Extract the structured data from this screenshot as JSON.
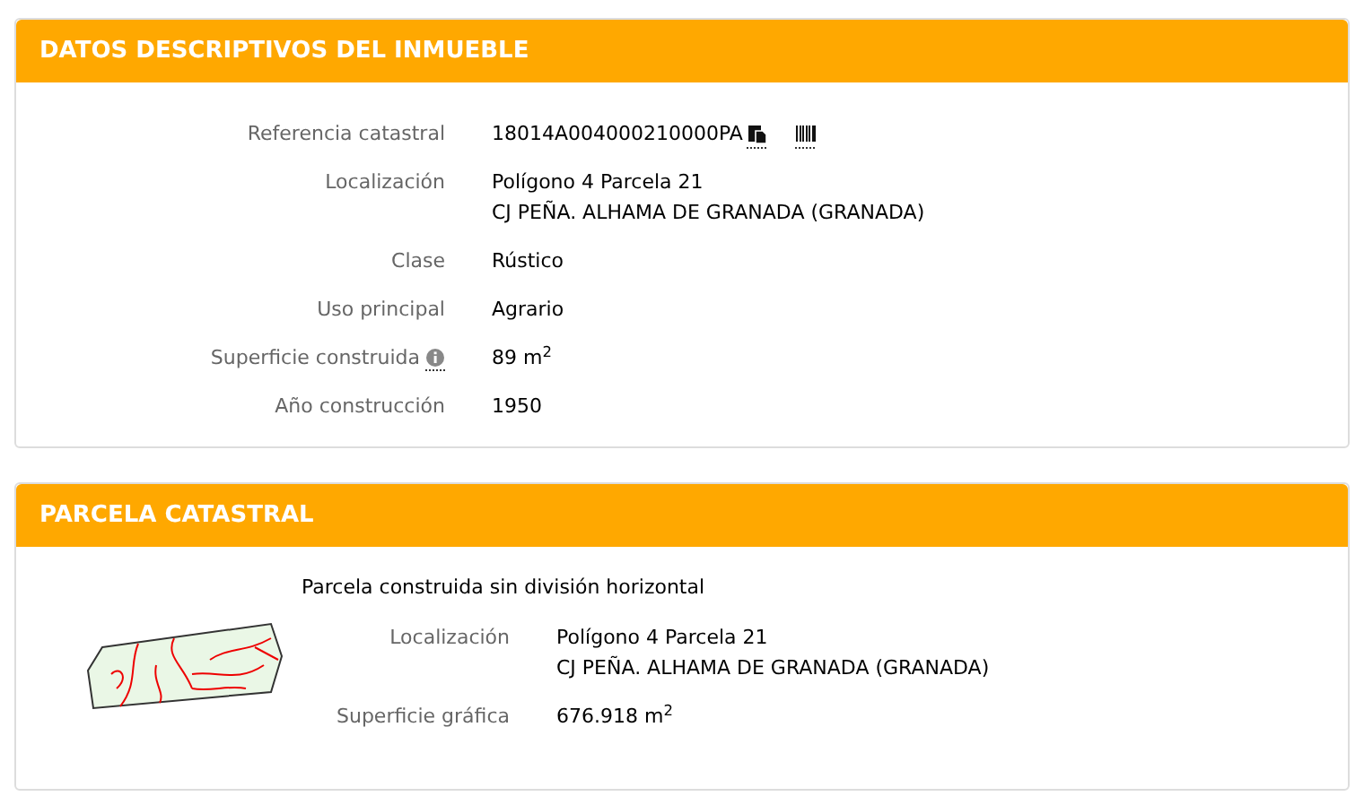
{
  "inmueble": {
    "title": "DATOS DESCRIPTIVOS DEL INMUEBLE",
    "fields": [
      {
        "kind": "reference",
        "label": "Referencia catastral",
        "lines": [
          "18014A004000210000PA"
        ]
      },
      {
        "kind": "plain",
        "label": "Localización",
        "lines": [
          "Polígono 4 Parcela 21",
          "CJ PEÑA. ALHAMA DE GRANADA (GRANADA)"
        ]
      },
      {
        "kind": "plain",
        "label": "Clase",
        "lines": [
          "Rústico"
        ]
      },
      {
        "kind": "plain",
        "label": "Uso principal",
        "lines": [
          "Agrario"
        ]
      },
      {
        "kind": "info",
        "label": "Superficie construida",
        "lines": [
          "89 m$^{2}$"
        ]
      },
      {
        "kind": "plain",
        "label": "Año construcción",
        "lines": [
          "1950"
        ]
      }
    ]
  },
  "parcela": {
    "title": "PARCELA CATASTRAL",
    "note": "Parcela construida sin división horizontal",
    "fields": [
      {
        "label": "Localización",
        "lines": [
          "Polígono 4 Parcela 21",
          "CJ PEÑA. ALHAMA DE GRANADA (GRANADA)"
        ]
      },
      {
        "label": "Superficie gráfica",
        "lines": [
          "676.918 m$^{2}$"
        ]
      }
    ]
  }
}
